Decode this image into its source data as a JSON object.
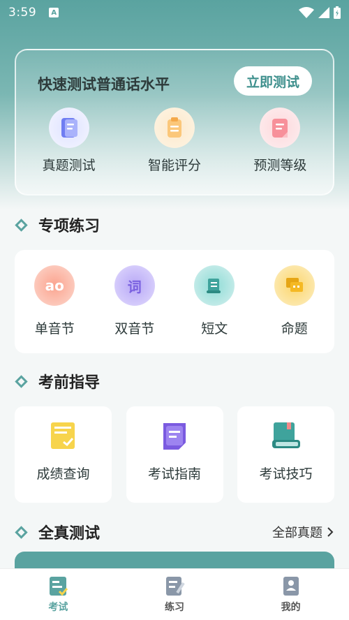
{
  "statusbar": {
    "time": "3:59",
    "notif": "A"
  },
  "hero": {
    "title": "快速测试普通话水平",
    "button": "立即测试",
    "items": [
      {
        "label": "真题测试",
        "icon": "document-icon"
      },
      {
        "label": "智能评分",
        "icon": "clipboard-icon"
      },
      {
        "label": "预测等级",
        "icon": "report-icon"
      }
    ]
  },
  "practice": {
    "title": "专项练习",
    "items": [
      {
        "label": "单音节",
        "icon_text": "ao"
      },
      {
        "label": "双音节",
        "icon_text": "词"
      },
      {
        "label": "短文",
        "icon_text": ""
      },
      {
        "label": "命题",
        "icon_text": ""
      }
    ]
  },
  "guide": {
    "title": "考前指导",
    "items": [
      {
        "label": "成绩查询"
      },
      {
        "label": "考试指南"
      },
      {
        "label": "考试技巧"
      }
    ]
  },
  "full": {
    "title": "全真测试",
    "more": "全部真题"
  },
  "tabs": [
    {
      "label": "考试",
      "active": true
    },
    {
      "label": "练习",
      "active": false
    },
    {
      "label": "我的",
      "active": false
    }
  ],
  "colors": {
    "accent": "#5aa3a0",
    "text": "#2d3a3a"
  }
}
